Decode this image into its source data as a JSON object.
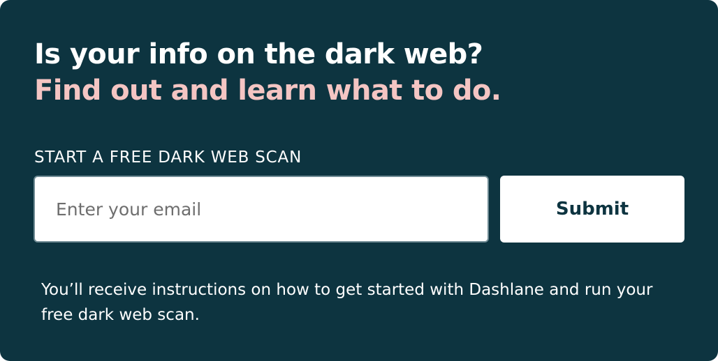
{
  "colors": {
    "background": "#0d3440",
    "accent_pink": "#f4c5c3",
    "text_light": "#ffffff",
    "button_text": "#0d3440"
  },
  "headline": {
    "line1": "Is your info on the dark web?",
    "line2": "Find out and learn what to do."
  },
  "form": {
    "label": "START A FREE DARK WEB SCAN",
    "email_placeholder": "Enter your email",
    "email_value": "",
    "submit_label": "Submit"
  },
  "notice": {
    "text": "You’ll receive instructions on how to get started with Dashlane and run your free dark web scan."
  }
}
